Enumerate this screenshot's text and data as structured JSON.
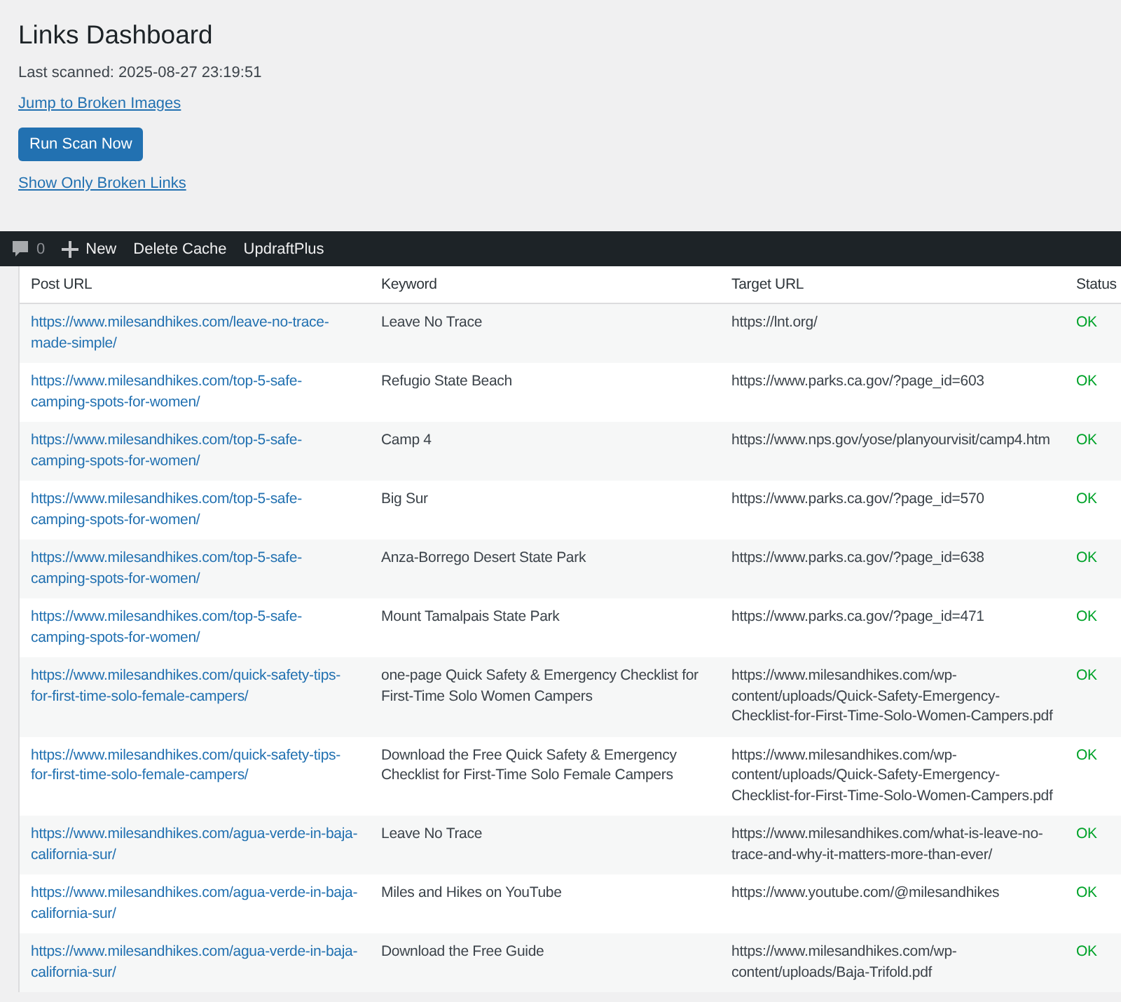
{
  "page": {
    "title": "Links Dashboard",
    "last_scanned": "Last scanned: 2025-08-27 23:19:51",
    "jump_link": "Jump to Broken Images",
    "scan_button": "Run Scan Now",
    "filter_link": "Show Only Broken Links"
  },
  "admin_bar": {
    "comments_count": "0",
    "new_label": "New",
    "items": [
      "Delete Cache",
      "UpdraftPlus"
    ]
  },
  "table": {
    "columns": [
      "Post URL",
      "Keyword",
      "Target URL",
      "Status"
    ],
    "rows": [
      {
        "post_url": "https://www.milesandhikes.com/leave-no-trace-made-simple/",
        "keyword": "Leave No Trace",
        "target_url": "https://lnt.org/",
        "status": "OK"
      },
      {
        "post_url": "https://www.milesandhikes.com/top-5-safe-camping-spots-for-women/",
        "keyword": "Refugio State Beach",
        "target_url": "https://www.parks.ca.gov/?page_id=603",
        "status": "OK"
      },
      {
        "post_url": "https://www.milesandhikes.com/top-5-safe-camping-spots-for-women/",
        "keyword": "Camp 4",
        "target_url": "https://www.nps.gov/yose/planyourvisit/camp4.htm",
        "status": "OK"
      },
      {
        "post_url": "https://www.milesandhikes.com/top-5-safe-camping-spots-for-women/",
        "keyword": "Big Sur",
        "target_url": "https://www.parks.ca.gov/?page_id=570",
        "status": "OK"
      },
      {
        "post_url": "https://www.milesandhikes.com/top-5-safe-camping-spots-for-women/",
        "keyword": "Anza-Borrego Desert State Park",
        "target_url": "https://www.parks.ca.gov/?page_id=638",
        "status": "OK"
      },
      {
        "post_url": "https://www.milesandhikes.com/top-5-safe-camping-spots-for-women/",
        "keyword": "Mount Tamalpais State Park",
        "target_url": "https://www.parks.ca.gov/?page_id=471",
        "status": "OK"
      },
      {
        "post_url": "https://www.milesandhikes.com/quick-safety-tips-for-first-time-solo-female-campers/",
        "keyword": "one-page Quick Safety & Emergency Checklist for First-Time Solo Women Campers",
        "target_url": "https://www.milesandhikes.com/wp-content/uploads/Quick-Safety-Emergency-Checklist-for-First-Time-Solo-Women-Campers.pdf",
        "status": "OK"
      },
      {
        "post_url": "https://www.milesandhikes.com/quick-safety-tips-for-first-time-solo-female-campers/",
        "keyword": "Download the Free Quick Safety & Emergency Checklist for First-Time Solo Female Campers",
        "target_url": "https://www.milesandhikes.com/wp-content/uploads/Quick-Safety-Emergency-Checklist-for-First-Time-Solo-Women-Campers.pdf",
        "status": "OK"
      },
      {
        "post_url": "https://www.milesandhikes.com/agua-verde-in-baja-california-sur/",
        "keyword": "Leave No Trace",
        "target_url": "https://www.milesandhikes.com/what-is-leave-no-trace-and-why-it-matters-more-than-ever/",
        "status": "OK"
      },
      {
        "post_url": "https://www.milesandhikes.com/agua-verde-in-baja-california-sur/",
        "keyword": "Miles and Hikes on YouTube",
        "target_url": "https://www.youtube.com/@milesandhikes",
        "status": "OK"
      },
      {
        "post_url": "https://www.milesandhikes.com/agua-verde-in-baja-california-sur/",
        "keyword": "Download the Free Guide",
        "target_url": "https://www.milesandhikes.com/wp-content/uploads/Baja-Trifold.pdf",
        "status": "OK"
      }
    ]
  }
}
